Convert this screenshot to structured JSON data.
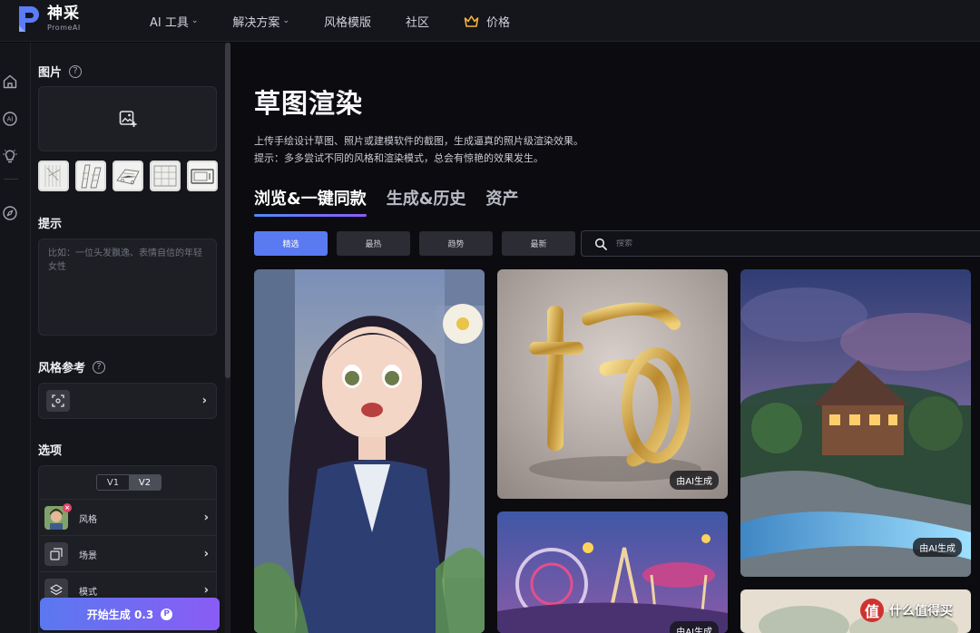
{
  "brand": {
    "name_cn": "神采",
    "name_en": "PromeAI"
  },
  "nav": {
    "items": [
      {
        "label": "AI 工具",
        "has_caret": true
      },
      {
        "label": "解决方案",
        "has_caret": true
      },
      {
        "label": "风格模版",
        "has_caret": false
      },
      {
        "label": "社区",
        "has_caret": false
      },
      {
        "label": "价格",
        "has_caret": false,
        "icon": "crown-icon"
      }
    ]
  },
  "rail": {
    "icons": [
      "home-icon",
      "ai-icon",
      "bulb-icon",
      "compass-icon"
    ]
  },
  "panel": {
    "image_title": "图片",
    "prompt_title": "提示",
    "prompt_placeholder": "比如：一位头发飘逸、表情自信的年轻女性",
    "style_ref_title": "风格参考",
    "options_title": "选项",
    "versions": [
      "V1",
      "V2"
    ],
    "active_version": "V2",
    "option_rows": [
      {
        "label": "风格",
        "icon": "portrait-thumbnail"
      },
      {
        "label": "场景",
        "icon": "scene-icon"
      },
      {
        "label": "模式",
        "icon": "mode-icon"
      }
    ],
    "generate_label": "开始生成 0.3"
  },
  "main": {
    "title": "草图渲染",
    "desc_line1": "上传手绘设计草图、照片或建模软件的截图，生成逼真的照片级渲染效果。",
    "desc_line2": "提示：多多尝试不同的风格和渲染模式，总会有惊艳的效果发生。",
    "tabs": [
      "浏览&一键同款",
      "生成&历史",
      "资产"
    ],
    "active_tab": "浏览&一键同款",
    "filters": [
      "精选",
      "最热",
      "趋势",
      "最新"
    ],
    "active_filter": "精选",
    "search_placeholder": "搜索",
    "ai_badge": "由AI生成"
  },
  "watermark": {
    "logo": "值",
    "text": "什么值得买"
  },
  "colors": {
    "accent": "#5a7af2",
    "accent2": "#8d5cf6",
    "bg": "#0c0c10",
    "panel": "#15161b"
  }
}
